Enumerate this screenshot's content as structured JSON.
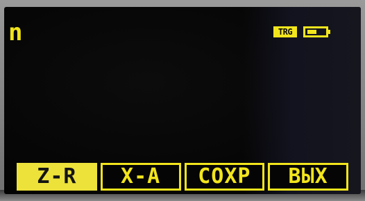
{
  "display": {
    "mode_label": "n",
    "status": {
      "trigger_badge": "TRG",
      "battery_icon": "battery-icon",
      "battery_level": 0.5
    },
    "softkeys": [
      {
        "label": "Z-R",
        "active": true
      },
      {
        "label": "X-A",
        "active": false
      },
      {
        "label": "СОХР",
        "active": false
      },
      {
        "label": "ВЫХ",
        "active": false
      }
    ]
  },
  "colors": {
    "lcd_yellow": "#f2e51c",
    "lcd_background": "#050505",
    "active_key_fill": "#ece23a"
  }
}
